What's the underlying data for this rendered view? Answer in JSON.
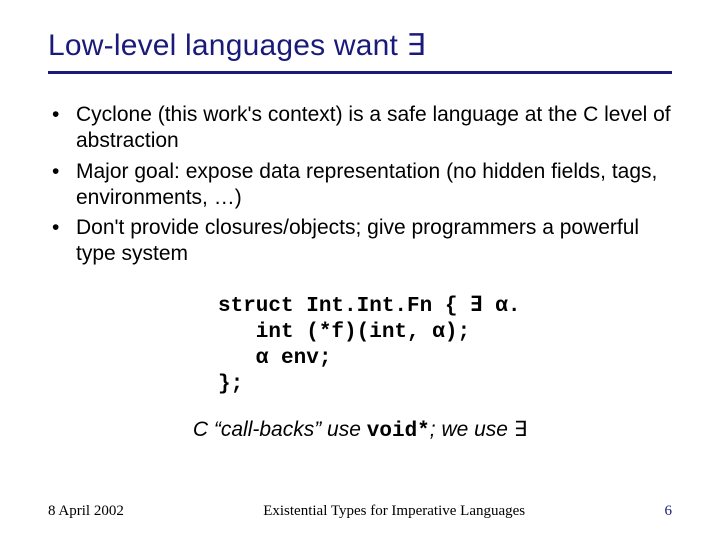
{
  "title": "Low-level languages want ∃",
  "bullets": [
    "Cyclone (this work's context) is a safe language at the C level of abstraction",
    "Major goal: expose data representation (no hidden fields, tags, environments, …)",
    "Don't provide closures/objects; give programmers a powerful type system"
  ],
  "code": "struct Int.Int.Fn { ∃ α.\n   int (*f)(int, α);\n   α env;\n};",
  "callback_prefix": "C “call-backs” use ",
  "callback_mono": "void*",
  "callback_mid": "; we use ",
  "callback_symbol": "∃",
  "footer": {
    "date": "8 April 2002",
    "title": "Existential Types for Imperative Languages",
    "page": "6"
  }
}
